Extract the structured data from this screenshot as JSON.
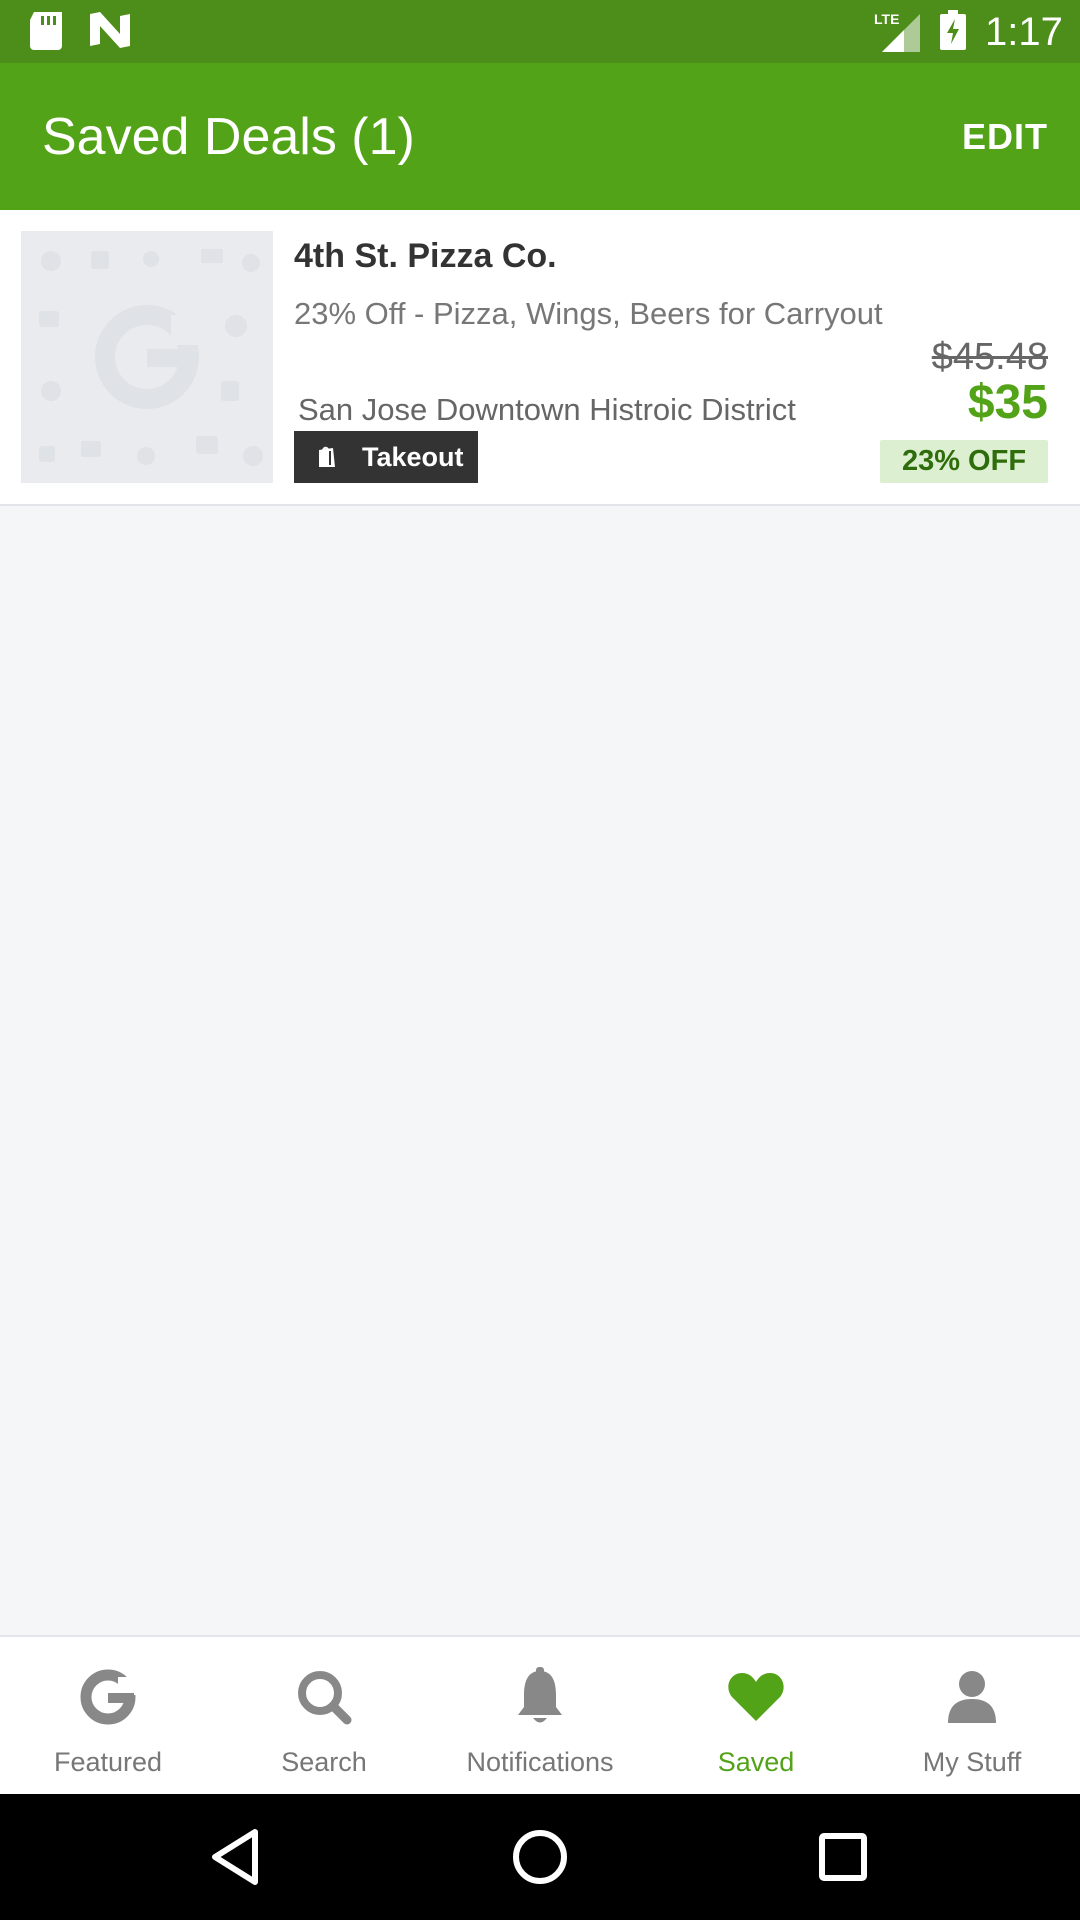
{
  "status_bar": {
    "time": "1:17",
    "network": "LTE",
    "icons": [
      "sd-card-icon",
      "n-notification-icon",
      "lte-signal-icon",
      "battery-charging-icon"
    ]
  },
  "app_bar": {
    "title": "Saved Deals (1)",
    "edit_label": "EDIT"
  },
  "deals": [
    {
      "merchant": "4th St. Pizza Co.",
      "title": "23% Off - Pizza, Wings, Beers for Carryout",
      "location": "San Jose Downtown Histroic District",
      "tag": "Takeout",
      "original_price": "$45.48",
      "sale_price": "$35",
      "discount": "23% OFF"
    }
  ],
  "bottom_nav": {
    "items": [
      {
        "label": "Featured",
        "icon": "groupon-g-icon",
        "active": false
      },
      {
        "label": "Search",
        "icon": "search-icon",
        "active": false
      },
      {
        "label": "Notifications",
        "icon": "bell-icon",
        "active": false
      },
      {
        "label": "Saved",
        "icon": "heart-icon",
        "active": true
      },
      {
        "label": "My Stuff",
        "icon": "person-icon",
        "active": false
      }
    ]
  },
  "system_nav": {
    "buttons": [
      "back-icon",
      "home-icon",
      "recents-icon"
    ]
  },
  "colors": {
    "brand_green": "#53a318",
    "status_bar_green": "#4d8d1a",
    "discount_badge_bg": "#dcefd1",
    "inactive_gray": "#777777"
  }
}
